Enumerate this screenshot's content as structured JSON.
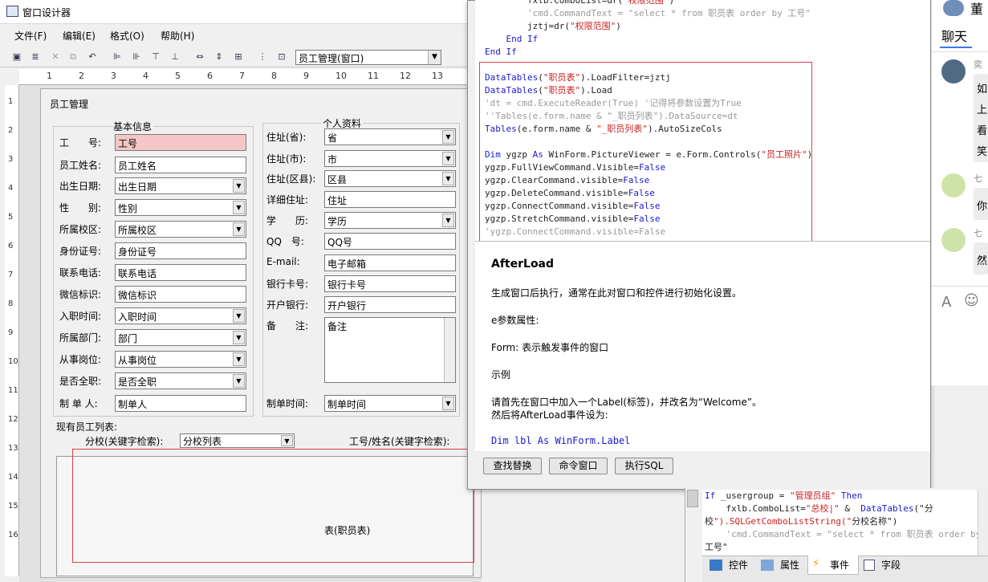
{
  "designer": {
    "title": "窗口设计器",
    "menu": [
      "文件(F)",
      "编辑(E)",
      "格式(O)",
      "帮助(H)"
    ],
    "window_select": "员工管理(窗口)",
    "ruler_top": [
      "1",
      "2",
      "3",
      "4",
      "5",
      "6",
      "7",
      "8",
      "9",
      "10",
      "11",
      "12",
      "13"
    ],
    "ruler_left": [
      "1",
      "2",
      "3",
      "4",
      "5",
      "6",
      "7",
      "8",
      "9",
      "10",
      "11",
      "12",
      "13",
      "14",
      "15",
      "16"
    ]
  },
  "form": {
    "title": "员工管理",
    "basic_group": "基本信息",
    "personal_group": "个人资料",
    "basic_fields": [
      {
        "label": "工　　号:",
        "value": "工号"
      },
      {
        "label": "员工姓名:",
        "value": "员工姓名"
      },
      {
        "label": "出生日期:",
        "value": "出生日期"
      },
      {
        "label": "性　　别:",
        "value": "性别"
      },
      {
        "label": "所属校区:",
        "value": "所属校区"
      },
      {
        "label": "身份证号:",
        "value": "身份证号"
      },
      {
        "label": "联系电话:",
        "value": "联系电话"
      },
      {
        "label": "微信标识:",
        "value": "微信标识"
      },
      {
        "label": "入职时间:",
        "value": "入职时间"
      },
      {
        "label": "所属部门:",
        "value": "部门"
      },
      {
        "label": "从事岗位:",
        "value": "从事岗位"
      },
      {
        "label": "是否全职:",
        "value": "是否全职"
      },
      {
        "label": "制 单 人:",
        "value": "制单人"
      }
    ],
    "personal_fields": [
      {
        "label": "住址(省):",
        "value": "省"
      },
      {
        "label": "住址(市):",
        "value": "市"
      },
      {
        "label": "住址(区县):",
        "value": "区县"
      },
      {
        "label": "详细住址:",
        "value": "住址"
      },
      {
        "label": "学　　历:",
        "value": "学历"
      },
      {
        "label": "QQ　号:",
        "value": "QQ号"
      },
      {
        "label": "E-mail:",
        "value": "电子邮箱"
      },
      {
        "label": "银行卡号:",
        "value": "银行卡号"
      },
      {
        "label": "开户银行:",
        "value": "开户银行"
      },
      {
        "label": "备　　注:",
        "value": "备注"
      },
      {
        "label": "制单时间:",
        "value": "制单时间"
      }
    ],
    "list_label": "现有员工列表:",
    "branch_search_label": "分校(关键字检索):",
    "branch_search_value": "分校列表",
    "id_name_search_label": "工号/姓名(关键字检索):",
    "table_text": "表(职员表)"
  },
  "code": {
    "lines_top": [
      "        fxlb.ComboList=dr(\"权限范围\")",
      "        'cmd.CommandText = \"select * from 职员表 order by 工号\"",
      "        jztj=dr(\"权限范围\")",
      "    End If",
      "End If"
    ],
    "lines_box": [
      "DataTables(\"职员表\").LoadFilter=jztj",
      "DataTables(\"职员表\").Load",
      "'dt = cmd.ExecuteReader(True) '记得将参数设置为True",
      "''Tables(e.form.name & \"_职员列表\").DataSource=dt",
      "Tables(e.form.name & \"_职员列表\").AutoSizeCols",
      "",
      "Dim ygzp As WinForm.PictureViewer = e.Form.Controls(\"员工照片\")",
      "ygzp.FullViewCommand.Visible=False",
      "ygzp.ClearCommand.visible=False",
      "ygzp.DeleteCommand.visible=False",
      "ygzp.ConnectCommand.visible=False",
      "ygzp.StretchCommand.visible=False",
      "'ygzp.ConnectCommand.visible=False"
    ]
  },
  "help": {
    "heading": "AfterLoad",
    "p1": "生成窗口后执行，通常在此对窗口和控件进行初始化设置。",
    "p2": "e参数属性:",
    "p3": "Form: 表示触发事件的窗口",
    "p4": "示例",
    "p5": "请首先在窗口中加入一个Label(标签)，并改名为“Welcome”。",
    "p6": "然后将AfterLoad事件设为:",
    "p7": "Dim lbl As WinForm.Label"
  },
  "buttons": {
    "find_replace": "查找替换",
    "command_window": "命令窗口",
    "execute_sql": "执行SQL"
  },
  "chat": {
    "header_partial": "董",
    "tab": "聊天",
    "names": [
      "奕",
      "七",
      "七"
    ],
    "bubble1": [
      "如",
      "上",
      "看",
      "笑"
    ],
    "bubble2": "你",
    "bubble3": "然"
  },
  "bottom_code": [
    "If _usergroup = \"管理员组\" Then",
    "    fxlb.ComboList=\"总校|\" &  DataTables(\"分",
    "校\").SQLGetComboListString(\"分校名称\")",
    "    'cmd.CommandText = \"select * from 职员表 order by",
    "工号\""
  ],
  "bottom_tabs": [
    "控件",
    "属性",
    "事件",
    "字段"
  ]
}
